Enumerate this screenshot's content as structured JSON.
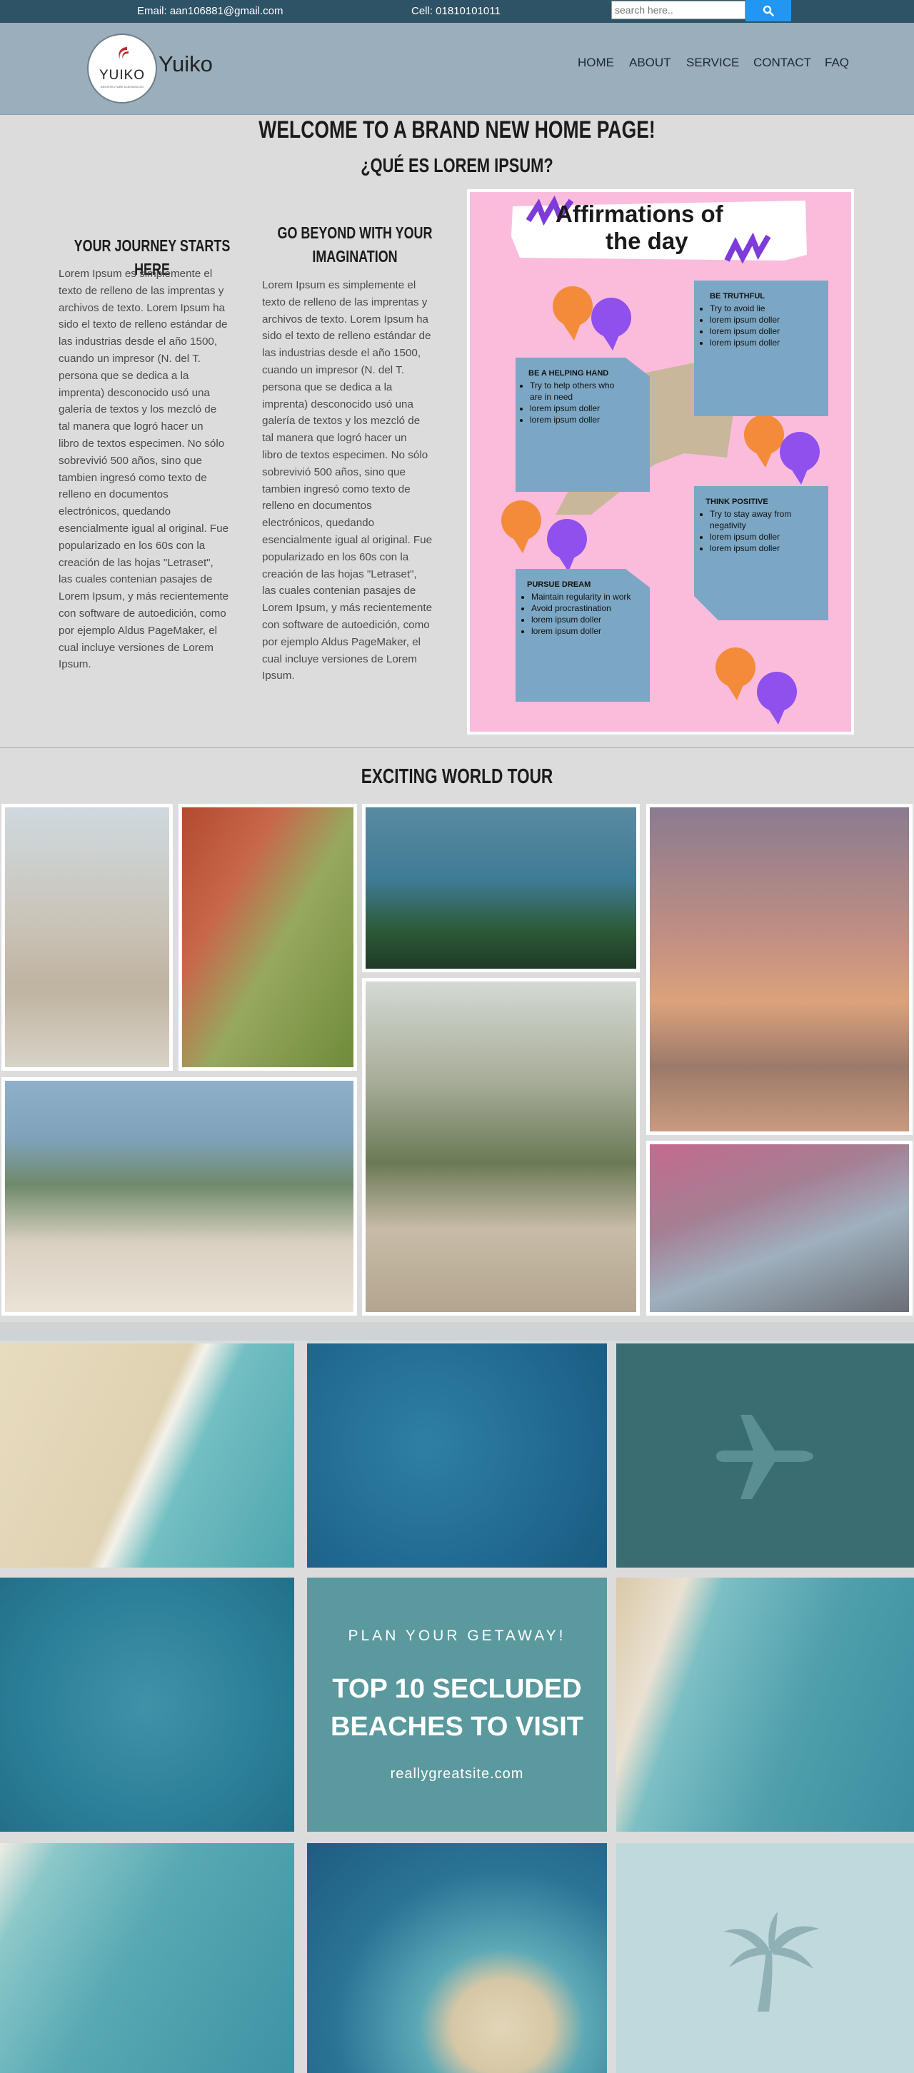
{
  "topbar": {
    "email": "Email: aan106881@gmail.com",
    "cell": "Cell: 01810101011",
    "search_placeholder": "search here.."
  },
  "brand": {
    "logo_text": "YUIKO",
    "logo_subtext": "ARCHITECTURE & DESIGN LTD",
    "name": "Yuiko"
  },
  "nav": {
    "items": [
      "HOME",
      "ABOUT",
      "SERVICE",
      "CONTACT",
      "FAQ"
    ]
  },
  "hero": {
    "title": "WELCOME TO A BRAND NEW HOME PAGE!",
    "subtitle": "¿QUÉ ES LOREM IPSUM?"
  },
  "columns": [
    {
      "title": "YOUR JOURNEY STARTS HERE",
      "lines": [
        "Lorem Ipsum es simplemente el",
        "texto de relleno de las imprentas y",
        "archivos de texto. Lorem Ipsum ha",
        "sido el texto de relleno estándar de",
        "las industrias desde el año 1500,",
        "cuando un impresor (N. del T.",
        "persona que se dedica a la",
        "imprenta) desconocido usó una",
        "galería de textos y los mezcló de",
        "tal manera que logró hacer un",
        "libro de textos especimen. No sólo",
        "sobrevivió 500 años, sino que",
        "tambien ingresó como texto de",
        "relleno en documentos",
        "electrónicos, quedando",
        "esencialmente igual al original. Fue",
        "popularizado en los 60s con la",
        "creación de las hojas \"Letraset\",",
        "las cuales contenian pasajes de",
        "Lorem Ipsum, y más recientemente",
        "con software de autoedición, como",
        "por ejemplo Aldus PageMaker, el",
        "cual incluye versiones de Lorem",
        "Ipsum."
      ]
    },
    {
      "title_lines": [
        "GO BEYOND WITH YOUR",
        "IMAGINATION"
      ],
      "lines": [
        "Lorem Ipsum es simplemente el",
        "texto de relleno de las imprentas y",
        "archivos de texto. Lorem Ipsum ha",
        "sido el texto de relleno estándar de",
        "las industrias desde el año 1500,",
        "cuando un impresor (N. del T.",
        "persona que se dedica a la",
        "imprenta) desconocido usó una",
        "galería de textos y los mezcló de",
        "tal manera que logró hacer un",
        "libro de textos especimen. No sólo",
        "sobrevivió 500 años, sino que",
        "tambien ingresó como texto de",
        "relleno en documentos",
        "electrónicos, quedando",
        "esencialmente igual al original. Fue",
        "popularizado en los 60s con la",
        "creación de las hojas \"Letraset\",",
        "las cuales contenian pasajes de",
        "Lorem Ipsum, y más recientemente",
        "con software de autoedición, como",
        "por ejemplo Aldus PageMaker, el",
        "cual incluye versiones de Lorem",
        "Ipsum."
      ]
    }
  ],
  "poster": {
    "title_line1": "Affirmations of",
    "title_line2": "the day",
    "cards": [
      {
        "heading": "BE TRUTHFUL",
        "items": [
          "Try to avoid lie",
          "lorem ipsum doller",
          "lorem ipsum doller",
          "lorem ipsum doller"
        ]
      },
      {
        "heading": "BE A HELPING HAND",
        "items": [
          "Try to help others who are in need",
          "lorem ipsum doller",
          "lorem ipsum doller"
        ]
      },
      {
        "heading": "THINK POSITIVE",
        "items": [
          "Try to stay away from negativity",
          "lorem ipsum doller",
          "lorem ipsum doller"
        ]
      },
      {
        "heading": "PURSUE DREAM",
        "items": [
          "Maintain regularity in work",
          "Avoid procrastination",
          "lorem ipsum doller",
          "lorem ipsum doller"
        ]
      }
    ]
  },
  "tour": {
    "title": "EXCITING WORLD TOUR"
  },
  "promo": {
    "kicker": "PLAN YOUR GETAWAY!",
    "headline_line1": "TOP 10 SECLUDED",
    "headline_line2": "BEACHES TO VISIT",
    "url": "reallygreatsite.com"
  },
  "colors": {
    "topbar": "#2e5266",
    "navbar": "#9aaebb",
    "page_bg": "#dcdcdc",
    "search_button": "#2196f3",
    "poster_bg": "#fbbcdc",
    "promo_tile": "#5a999e"
  },
  "icons": [
    "search-icon",
    "airplane-icon",
    "palm-tree-icon"
  ]
}
